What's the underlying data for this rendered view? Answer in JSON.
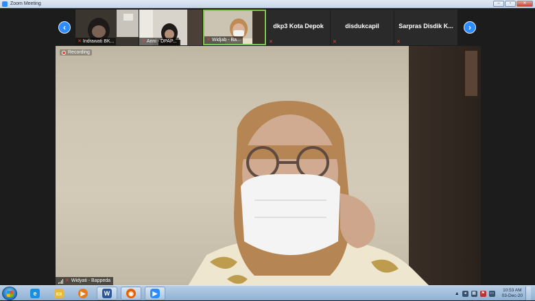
{
  "window": {
    "title": "Zoom Meeting",
    "buttons": [
      "–",
      "▫",
      "✕"
    ]
  },
  "gallery": {
    "prev_icon": "‹",
    "next_icon": "›",
    "tiles": [
      {
        "name": "Indrawati BK...",
        "type": "video"
      },
      {
        "name": "Anni - DPAP...",
        "type": "video"
      },
      {
        "name": "Widjab - Ba...",
        "type": "video",
        "active": true
      },
      {
        "name": "dkp3 Kota Depok",
        "type": "name-only"
      },
      {
        "name": "disdukcapil",
        "type": "name-only"
      },
      {
        "name": "Sarpras Disdik K...",
        "type": "name-only"
      }
    ]
  },
  "main_video": {
    "recording_label": "Recording",
    "speaker_name": "Widyati - Bappeda"
  },
  "taskbar": {
    "apps": [
      {
        "name": "internet-explorer",
        "glyph": "e",
        "color": "#1a8fe0"
      },
      {
        "name": "file-explorer",
        "glyph": "▭",
        "color": "#e6b83c"
      },
      {
        "name": "media-player",
        "glyph": "▶",
        "color": "#e67a1c"
      },
      {
        "name": "word",
        "glyph": "W",
        "color": "#2b5797"
      },
      {
        "name": "firefox",
        "glyph": "◉",
        "color": "#e66000"
      },
      {
        "name": "zoom",
        "glyph": "▶",
        "color": "#2d8cff"
      }
    ],
    "tray_time": "10:53 AM",
    "tray_date": "03-Dec-20"
  }
}
